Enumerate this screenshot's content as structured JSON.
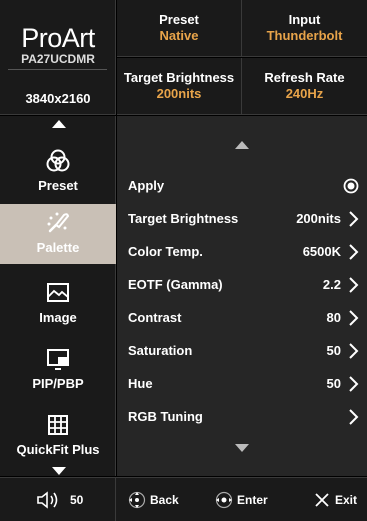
{
  "header": {
    "logo": "ProArt",
    "model": "PA27UCDMR",
    "resolution": "3840x2160",
    "info": [
      {
        "label": "Preset",
        "value": "Native"
      },
      {
        "label": "Input",
        "value": "Thunderbolt"
      },
      {
        "label": "Target Brightness",
        "value": "200nits"
      },
      {
        "label": "Refresh Rate",
        "value": "240Hz"
      }
    ]
  },
  "sidebar": {
    "items": [
      {
        "label": "Preset",
        "icon": "preset-circles-icon"
      },
      {
        "label": "Palette",
        "icon": "palette-icon",
        "active": true
      },
      {
        "label": "Image",
        "icon": "image-icon"
      },
      {
        "label": "PIP/PBP",
        "icon": "pip-pbp-icon"
      },
      {
        "label": "QuickFit Plus",
        "icon": "quickfit-grid-icon"
      }
    ]
  },
  "menu": {
    "items": [
      {
        "label": "Apply",
        "value": "",
        "control": "radio-selected"
      },
      {
        "label": "Target Brightness",
        "value": "200nits",
        "control": "chevron"
      },
      {
        "label": "Color Temp.",
        "value": "6500K",
        "control": "chevron"
      },
      {
        "label": "EOTF (Gamma)",
        "value": "2.2",
        "control": "chevron"
      },
      {
        "label": "Contrast",
        "value": "80",
        "control": "chevron"
      },
      {
        "label": "Saturation",
        "value": "50",
        "control": "chevron"
      },
      {
        "label": "Hue",
        "value": "50",
        "control": "chevron"
      },
      {
        "label": "RGB Tuning",
        "value": "",
        "control": "chevron"
      }
    ]
  },
  "footer": {
    "volume": "50",
    "back": "Back",
    "enter": "Enter",
    "exit": "Exit"
  },
  "colors": {
    "accent": "#e8a44a",
    "active_bg": "#c9c0b6",
    "panel": "#1a1a1a",
    "menu_bg": "#262626"
  }
}
